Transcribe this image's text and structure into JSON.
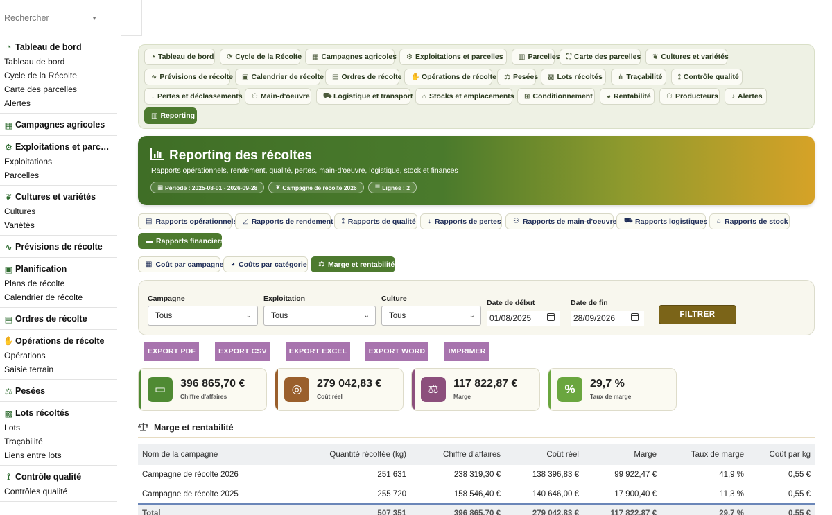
{
  "sidebar": {
    "search_placeholder": "Rechercher",
    "groups": [
      {
        "title": "Tableau de bord",
        "icon": "gauge-icon",
        "items": [
          "Tableau de bord",
          "Cycle de la Récolte",
          "Carte des parcelles",
          "Alertes"
        ]
      },
      {
        "title": "Campagnes agricoles",
        "icon": "calendar-icon",
        "items": []
      },
      {
        "title": "Exploitations et parc…",
        "icon": "tractor-icon",
        "items": [
          "Exploitations",
          "Parcelles"
        ]
      },
      {
        "title": "Cultures et variétés",
        "icon": "seedling-icon",
        "items": [
          "Cultures",
          "Variétés"
        ]
      },
      {
        "title": "Prévisions de récolte",
        "icon": "chart-line-icon",
        "items": []
      },
      {
        "title": "Planification",
        "icon": "calendar-check-icon",
        "items": [
          "Plans de récolte",
          "Calendrier de récolte"
        ]
      },
      {
        "title": "Ordres de récolte",
        "icon": "clipboard-check-icon",
        "items": []
      },
      {
        "title": "Opérations de récolte",
        "icon": "hand-icon",
        "items": [
          "Opérations",
          "Saisie terrain"
        ]
      },
      {
        "title": "Pesées",
        "icon": "scale-icon",
        "items": []
      },
      {
        "title": "Lots récoltés",
        "icon": "boxes-icon",
        "items": [
          "Lots",
          "Traçabilité",
          "Liens entre lots"
        ]
      },
      {
        "title": "Contrôle qualité",
        "icon": "hand-holding-icon",
        "items": [
          "Contrôles qualité"
        ]
      }
    ]
  },
  "modnav": [
    {
      "label": "Tableau de bord",
      "icon": "gauge-icon"
    },
    {
      "label": "Cycle de la Récolte",
      "icon": "sync-icon"
    },
    {
      "label": "Campagnes agricoles",
      "icon": "calendar-icon"
    },
    {
      "label": "Exploitations et parcelles",
      "icon": "tractor-icon"
    },
    {
      "label": "Parcelles",
      "icon": "map-icon"
    },
    {
      "label": "Carte des parcelles",
      "icon": "map-marked-icon"
    },
    {
      "label": "Cultures et variétés",
      "icon": "seedling-icon"
    },
    {
      "label": "Prévisions de récolte",
      "icon": "chart-line-icon"
    },
    {
      "label": "Calendrier de récolte",
      "icon": "calendar-check-icon"
    },
    {
      "label": "Ordres de récolte",
      "icon": "clipboard-check-icon"
    },
    {
      "label": "Opérations de récolte",
      "icon": "hand-icon"
    },
    {
      "label": "Pesées",
      "icon": "scale-icon"
    },
    {
      "label": "Lots récoltés",
      "icon": "boxes-icon"
    },
    {
      "label": "Traçabilité",
      "icon": "sitemap-icon"
    },
    {
      "label": "Contrôle qualité",
      "icon": "hand-holding-icon"
    },
    {
      "label": "Pertes et déclassements",
      "icon": "arrow-down-icon"
    },
    {
      "label": "Main-d'oeuvre",
      "icon": "users-icon"
    },
    {
      "label": "Logistique et transport",
      "icon": "truck-icon"
    },
    {
      "label": "Stocks et emplacements",
      "icon": "warehouse-icon"
    },
    {
      "label": "Conditionnement",
      "icon": "pallet-icon"
    },
    {
      "label": "Rentabilité",
      "icon": "pie-chart-icon"
    },
    {
      "label": "Producteurs",
      "icon": "user-group-icon"
    },
    {
      "label": "Alertes",
      "icon": "bell-icon"
    },
    {
      "label": "Reporting",
      "icon": "bar-chart-icon",
      "active": true
    }
  ],
  "banner": {
    "title": "Reporting des récoltes",
    "subtitle": "Rapports opérationnels, rendement, qualité, pertes, main-d'oeuvre, logistique, stock et finances",
    "chips": [
      "Période : 2025-08-01 - 2026-09-28",
      "Campagne de récolte 2026",
      "Lignes : 2"
    ]
  },
  "report_tabs": [
    {
      "label": "Rapports opérationnels",
      "icon": "clipboard-icon"
    },
    {
      "label": "Rapports de rendement",
      "icon": "chart-area-icon"
    },
    {
      "label": "Rapports de qualité",
      "icon": "hand-holding-icon"
    },
    {
      "label": "Rapports de pertes",
      "icon": "arrow-down-icon"
    },
    {
      "label": "Rapports de main-d'oeuvre",
      "icon": "users-icon"
    },
    {
      "label": "Rapports logistiques",
      "icon": "truck-icon"
    },
    {
      "label": "Rapports de stock",
      "icon": "warehouse-icon"
    },
    {
      "label": "Rapports financiers",
      "icon": "money-icon",
      "active": true
    }
  ],
  "sub_tabs": [
    {
      "label": "Coût par campagne",
      "icon": "calendar-icon"
    },
    {
      "label": "Coûts par catégorie",
      "icon": "pie-chart-icon"
    },
    {
      "label": "Marge et rentabilité",
      "icon": "scale-icon",
      "active": true
    }
  ],
  "filters": {
    "campagne_label": "Campagne",
    "campagne_value": "Tous",
    "exploitation_label": "Exploitation",
    "exploitation_value": "Tous",
    "culture_label": "Culture",
    "culture_value": "Tous",
    "date_debut_label": "Date de début",
    "date_debut_value": "01/08/2025",
    "date_fin_label": "Date de fin",
    "date_fin_value": "28/09/2026",
    "button": "FILTRER"
  },
  "exports": [
    "EXPORT PDF",
    "EXPORT CSV",
    "EXPORT EXCEL",
    "EXPORT WORD",
    "IMPRIMER"
  ],
  "kpis": [
    {
      "value": "396 865,70 €",
      "label": "Chiffre d'affaires",
      "icon": "money-bill-icon",
      "color": "#4f8a33"
    },
    {
      "value": "279 042,83 €",
      "label": "Coût réel",
      "icon": "coins-icon",
      "color": "#9a5f2c"
    },
    {
      "value": "117 822,87 €",
      "label": "Marge",
      "icon": "scale-icon",
      "color": "#8c4f7c"
    },
    {
      "value": "29,7 %",
      "label": "Taux de marge",
      "icon": "percent-icon",
      "color": "#6aa63f"
    }
  ],
  "section_title": "Marge et rentabilité",
  "table": {
    "headers": [
      "Nom de la campagne",
      "Quantité récoltée (kg)",
      "Chiffre d'affaires",
      "Coût réel",
      "Marge",
      "Taux de marge",
      "Coût par kg"
    ],
    "rows": [
      [
        "Campagne de récolte 2026",
        "251 631",
        "238 319,30 €",
        "138 396,83 €",
        "99 922,47 €",
        "41,9 %",
        "0,55 €"
      ],
      [
        "Campagne de récolte 2025",
        "255 720",
        "158 546,40 €",
        "140 646,00 €",
        "17 900,40 €",
        "11,3 %",
        "0,55 €"
      ]
    ],
    "total": [
      "Total",
      "507 351",
      "396 865,70 €",
      "279 042,83 €",
      "117 822,87 €",
      "29,7 %",
      "0,55 €"
    ]
  }
}
